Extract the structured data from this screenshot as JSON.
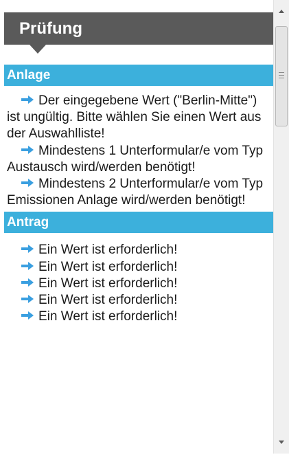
{
  "panel": {
    "title": "Prüfung"
  },
  "sections": [
    {
      "title": "Anlage",
      "messages": [
        {
          "text": "Der eingegebene Wert (\"Berlin-Mitte\") ist ungültig. Bitte wählen Sie einen Wert aus der Auswahlliste!"
        },
        {
          "text": "Mindestens 1 Unterformular/e vom Typ Austausch wird/werden benötigt!"
        },
        {
          "text": "Mindestens 2 Unterformular/e vom Typ Emissionen Anlage wird/werden benötigt!"
        }
      ]
    },
    {
      "title": "Antrag",
      "messages": [
        {
          "text": "Ein Wert ist erforderlich!"
        },
        {
          "text": "Ein Wert ist erforderlich!"
        },
        {
          "text": "Ein Wert ist erforderlich!"
        },
        {
          "text": "Ein Wert ist erforderlich!"
        },
        {
          "text": "Ein Wert ist erforderlich!"
        }
      ]
    }
  ],
  "icons": {
    "message_bullet": "arrow-right-icon",
    "scroll_up": "scroll-up-arrow-icon",
    "scroll_down": "scroll-down-arrow-icon"
  },
  "colors": {
    "header_bg": "#5a5a5a",
    "section_bg": "#3cb0dc",
    "arrow": "#3a9fe0",
    "text": "#1a1a1a"
  }
}
